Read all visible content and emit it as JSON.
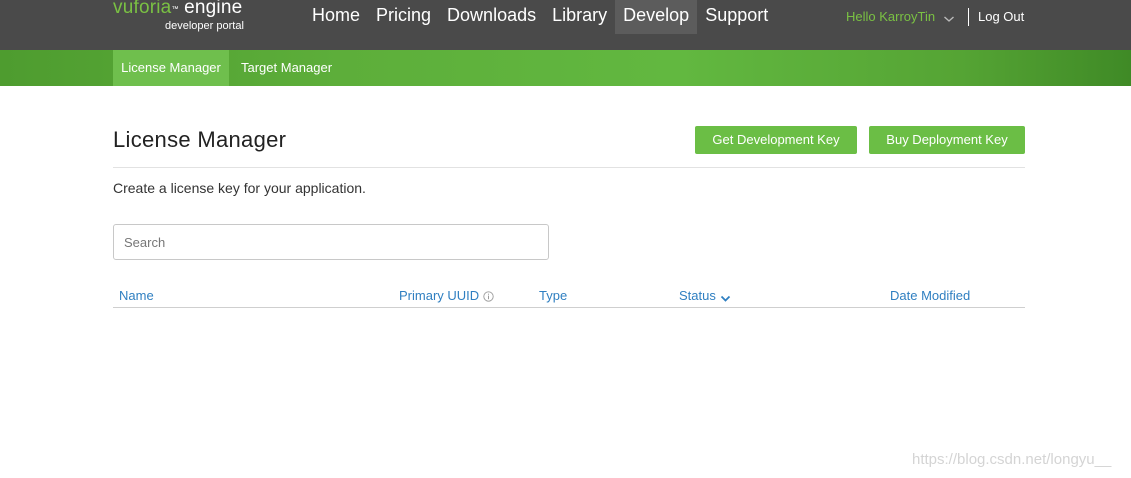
{
  "header": {
    "logo": {
      "brand": "vuforia",
      "tm": "™",
      "product": " engine",
      "sub": "developer portal"
    },
    "nav": [
      "Home",
      "Pricing",
      "Downloads",
      "Library",
      "Develop",
      "Support"
    ],
    "active_nav": "Develop",
    "user_greeting": "Hello KarroyTin",
    "logout_label": "Log Out"
  },
  "subnav": {
    "tabs": [
      "License Manager",
      "Target Manager"
    ],
    "active": "License Manager"
  },
  "main": {
    "title": "License Manager",
    "get_dev_key_label": "Get Development Key",
    "buy_deploy_key_label": "Buy Deployment Key",
    "description": "Create a license key for your application.",
    "search": {
      "placeholder": "Search",
      "value": ""
    },
    "table": {
      "columns": [
        "Name",
        "Primary UUID",
        "Type",
        "Status",
        "Date Modified"
      ],
      "rows": []
    }
  },
  "watermark": "https://blog.csdn.net/longyu__",
  "colors": {
    "header_bg": "#4a4a4a",
    "brand_green": "#7ac143",
    "button_green": "#6bbe45",
    "link_blue": "#2f7fc1"
  }
}
